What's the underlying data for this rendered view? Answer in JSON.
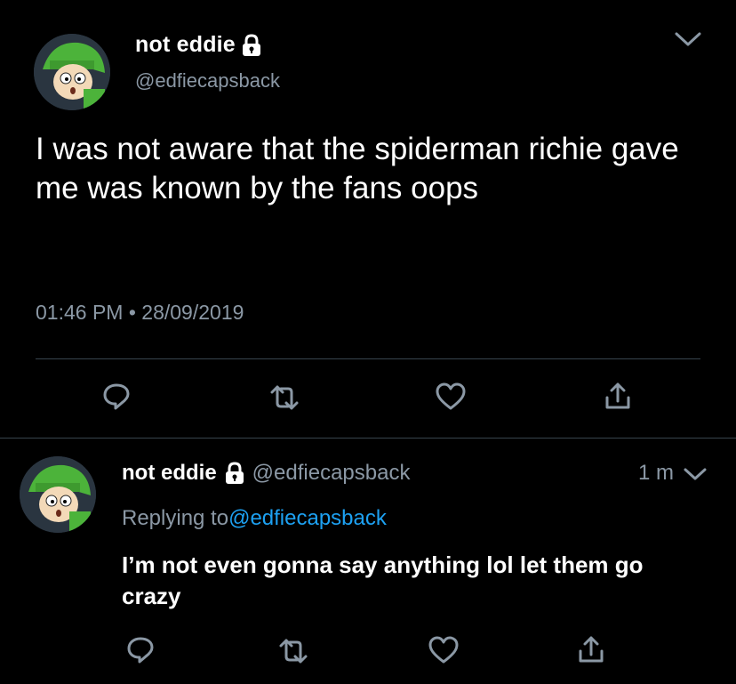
{
  "main_tweet": {
    "author_name": "not eddie",
    "handle": "@edfiecapsback",
    "text": "I was not aware that the spiderman richie gave me was known by the fans oops",
    "time": "01:46 PM",
    "separator": "•",
    "date": "28/09/2019",
    "icons": [
      "reply-icon",
      "retweet-icon",
      "like-icon",
      "share-icon"
    ]
  },
  "reply_tweet": {
    "author_name": "not eddie",
    "handle": "@edfiecapsback",
    "time_ago": "1 m",
    "replying_to_label": "Replying to",
    "replying_to_handle": "@edfiecapsback",
    "text": "I’m not even gonna say anything lol let them go crazy",
    "icons": [
      "reply-icon",
      "retweet-icon",
      "like-icon",
      "share-icon"
    ]
  },
  "colors": {
    "background": "#000000",
    "text_primary": "#ffffff",
    "text_secondary": "#8b98a5",
    "link": "#1da1f2",
    "divider": "#38444d"
  }
}
